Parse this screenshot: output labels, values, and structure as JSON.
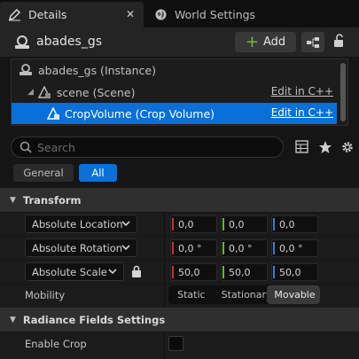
{
  "tabs": [
    {
      "label": "Details",
      "icon": "pencil-icon",
      "active": true
    },
    {
      "label": "World Settings",
      "icon": "globe-icon",
      "active": false
    }
  ],
  "actor": {
    "name": "abades_gs",
    "add_label": "Add"
  },
  "tree": [
    {
      "label": "abades_gs (Instance)",
      "edit": ""
    },
    {
      "label": "scene (Scene)",
      "edit": "Edit in C++"
    },
    {
      "label": "CropVolume (Crop Volume)",
      "edit": "Edit in C++"
    }
  ],
  "search": {
    "placeholder": "Search"
  },
  "filters": {
    "general": "General",
    "all": "All"
  },
  "transform": {
    "title": "Transform",
    "location": {
      "label": "Absolute Location",
      "x": "0,0",
      "y": "0,0",
      "z": "0,0"
    },
    "rotation": {
      "label": "Absolute Rotation",
      "x": "0,0 °",
      "y": "0,0 °",
      "z": "0,0 °"
    },
    "scale": {
      "label": "Absolute Scale",
      "x": "50,0",
      "y": "50,0",
      "z": "50,0"
    },
    "mobility": {
      "label": "Mobility",
      "options": [
        "Static",
        "Stationary",
        "Movable"
      ],
      "selected": "Movable"
    }
  },
  "radiance": {
    "title": "Radiance Fields Settings",
    "enable_crop": {
      "label": "Enable Crop",
      "checked": false
    }
  },
  "colors": {
    "accent": "#0870d8",
    "axis_x": "#c8302c",
    "axis_y": "#6bb33a",
    "axis_z": "#3a7dd8",
    "add_plus": "#6bc043"
  }
}
